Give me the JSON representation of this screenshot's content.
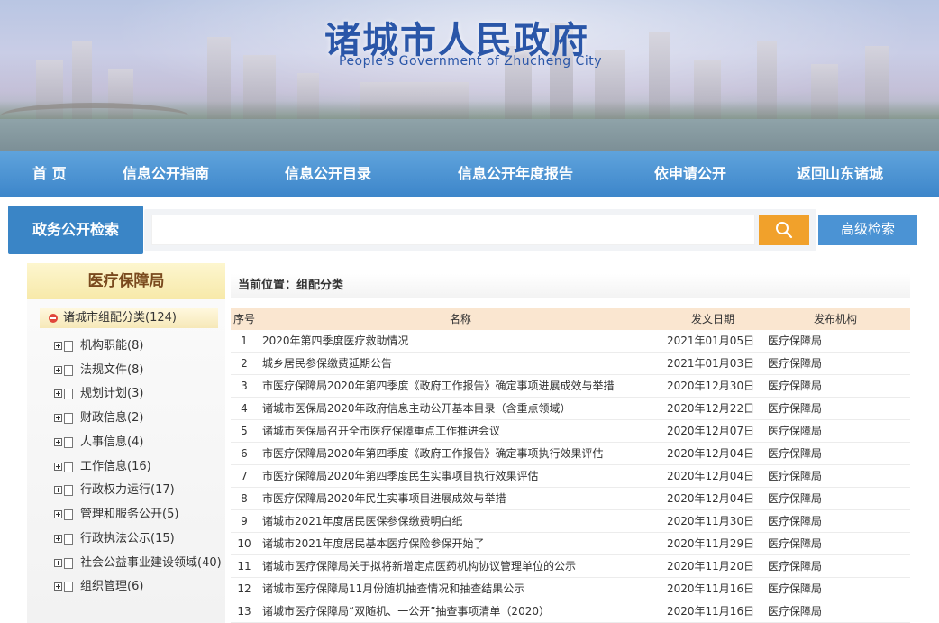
{
  "banner": {
    "title": "诸城市人民政府",
    "subtitle": "People's Government of Zhucheng City"
  },
  "nav": [
    "首  页",
    "信息公开指南",
    "信息公开目录",
    "信息公开年度报告",
    "依申请公开",
    "返回山东诸城"
  ],
  "search": {
    "tab_label": "政务公开检索",
    "input_value": "",
    "placeholder": "",
    "advanced_label": "高级检索",
    "button_icon": "search-icon"
  },
  "sidebar": {
    "title": "医疗保障局",
    "root_label": "诸城市组配分类(124)",
    "items": [
      "机构职能(8)",
      "法规文件(8)",
      "规划计划(3)",
      "财政信息(2)",
      "人事信息(4)",
      "工作信息(16)",
      "行政权力运行(17)",
      "管理和服务公开(5)",
      "行政执法公示(15)",
      "社会公益事业建设领域(40)",
      "组织管理(6)"
    ]
  },
  "breadcrumb": "当前位置：组配分类",
  "table": {
    "headers": [
      "序号",
      "名称",
      "发文日期",
      "发布机构"
    ],
    "rows": [
      {
        "idx": "1",
        "name": "2020年第四季度医疗救助情况",
        "date": "2021年01月05日",
        "org": "医疗保障局"
      },
      {
        "idx": "2",
        "name": "城乡居民参保缴费延期公告",
        "date": "2021年01月03日",
        "org": "医疗保障局"
      },
      {
        "idx": "3",
        "name": "市医疗保障局2020年第四季度《政府工作报告》确定事项进展成效与举措",
        "date": "2020年12月30日",
        "org": "医疗保障局"
      },
      {
        "idx": "4",
        "name": "诸城市医保局2020年政府信息主动公开基本目录（含重点领域）",
        "date": "2020年12月22日",
        "org": "医疗保障局"
      },
      {
        "idx": "5",
        "name": "诸城市医保局召开全市医疗保障重点工作推进会议",
        "date": "2020年12月07日",
        "org": "医疗保障局"
      },
      {
        "idx": "6",
        "name": "市医疗保障局2020年第四季度《政府工作报告》确定事项执行效果评估",
        "date": "2020年12月04日",
        "org": "医疗保障局"
      },
      {
        "idx": "7",
        "name": "市医疗保障局2020年第四季度民生实事项目执行效果评估",
        "date": "2020年12月04日",
        "org": "医疗保障局"
      },
      {
        "idx": "8",
        "name": "市医疗保障局2020年民生实事项目进展成效与举措",
        "date": "2020年12月04日",
        "org": "医疗保障局"
      },
      {
        "idx": "9",
        "name": "诸城市2021年度居民医保参保缴费明白纸",
        "date": "2020年11月30日",
        "org": "医疗保障局"
      },
      {
        "idx": "10",
        "name": "诸城市2021年度居民基本医疗保险参保开始了",
        "date": "2020年11月29日",
        "org": "医疗保障局"
      },
      {
        "idx": "11",
        "name": "诸城市医疗保障局关于拟将新增定点医药机构协议管理单位的公示",
        "date": "2020年11月20日",
        "org": "医疗保障局"
      },
      {
        "idx": "12",
        "name": "诸城市医疗保障局11月份随机抽查情况和抽查结果公示",
        "date": "2020年11月16日",
        "org": "医疗保障局"
      },
      {
        "idx": "13",
        "name": "诸城市医疗保障局“双随机、一公开”抽查事项清单（2020）",
        "date": "2020年11月16日",
        "org": "医疗保障局"
      }
    ]
  },
  "colors": {
    "nav_bg": "#3d86ca",
    "search_btn": "#f1a12b",
    "title_blue": "#2a56a8",
    "table_header": "#fae6d0",
    "sidebar_head": "#f7e9a9"
  }
}
